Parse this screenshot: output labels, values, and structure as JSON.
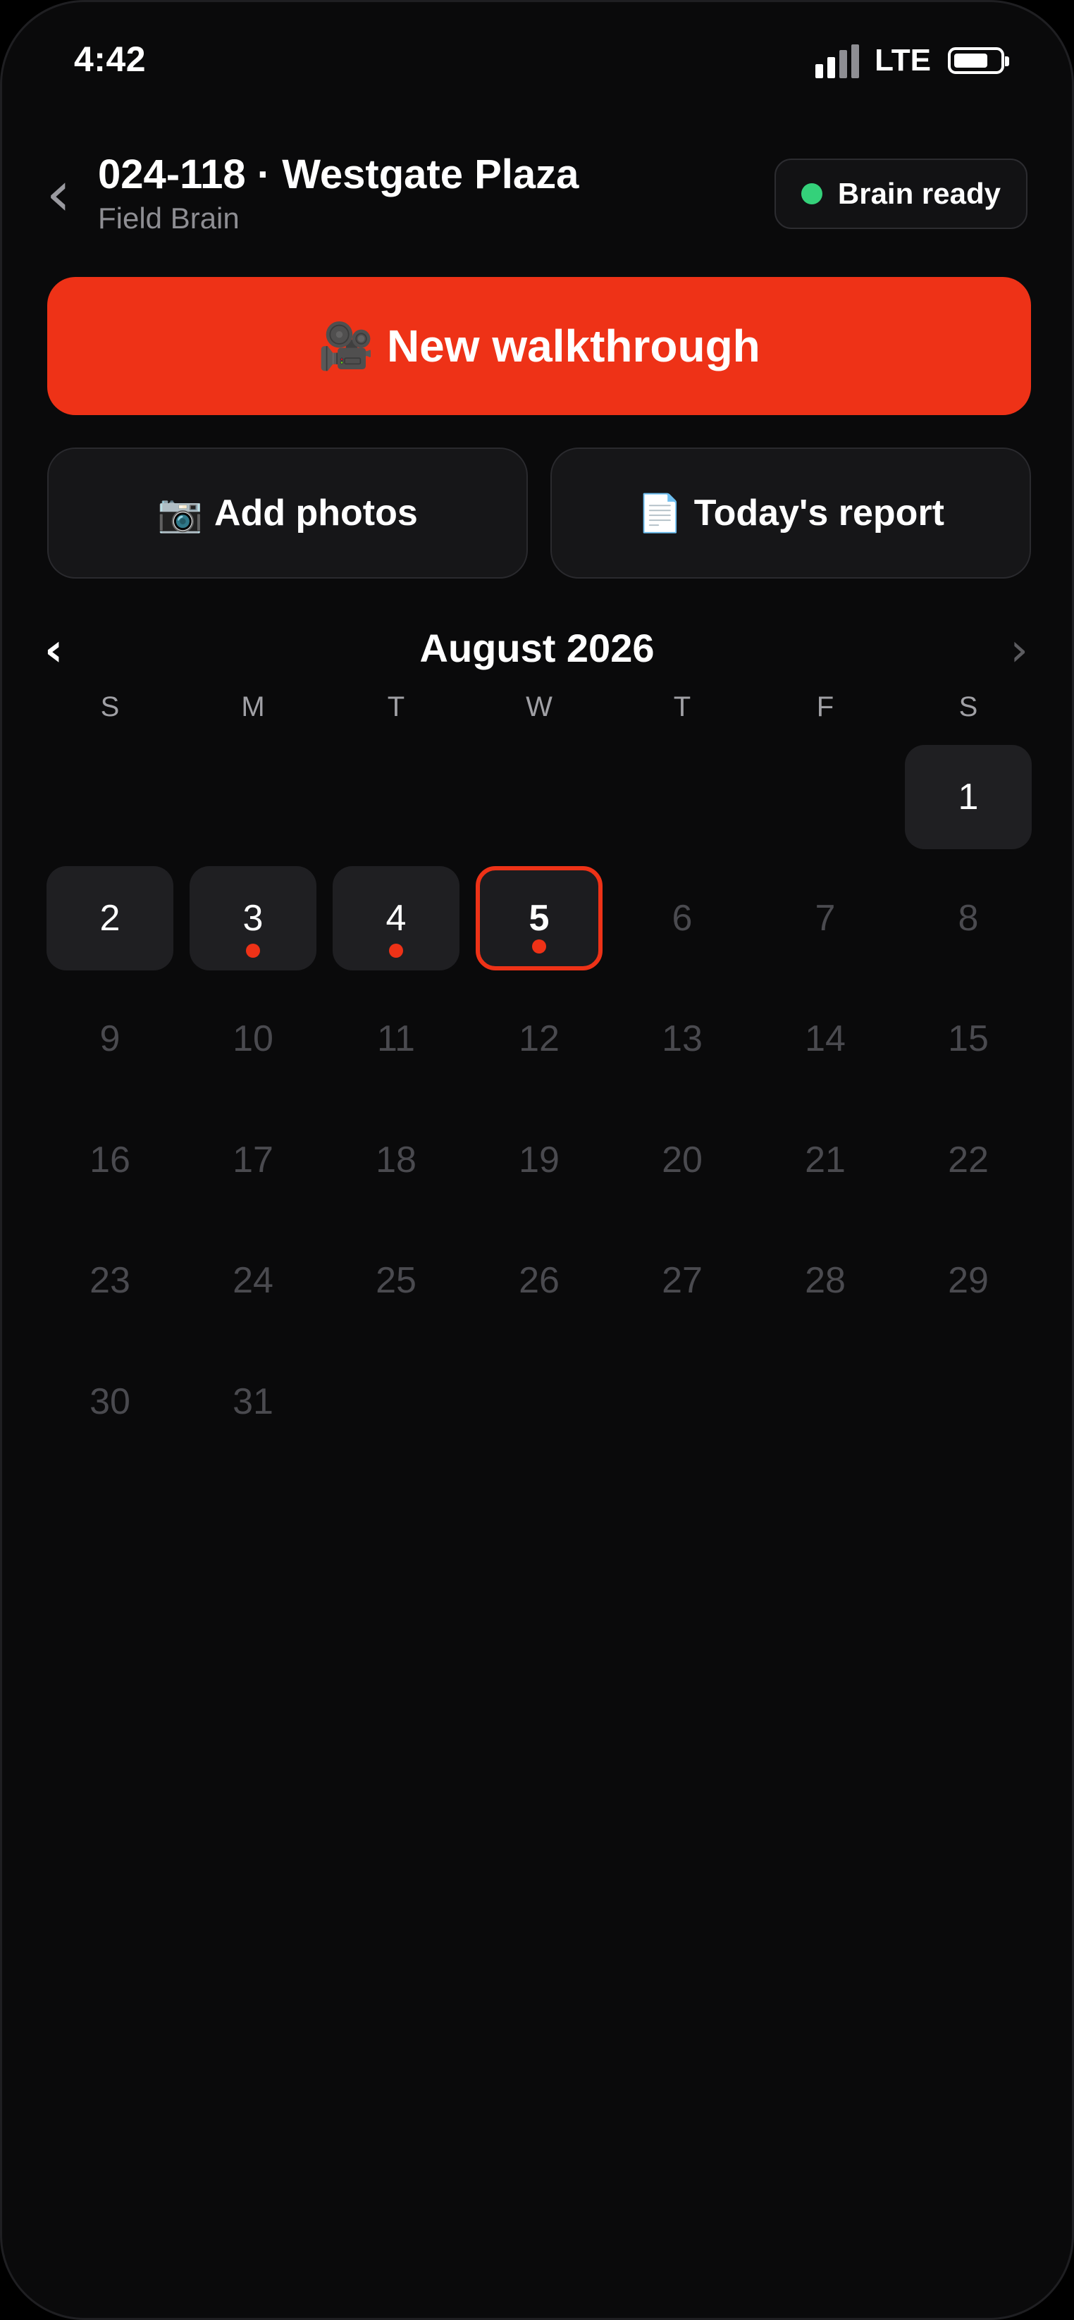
{
  "status_bar": {
    "time": "4:42",
    "network": "LTE",
    "battery_level": 0.75
  },
  "header": {
    "back_glyph": "‹",
    "title": "024-118 · Westgate Plaza",
    "subtitle": "Field Brain",
    "status": {
      "label": "Brain ready",
      "color": "#34d17a"
    }
  },
  "actions": {
    "primary": {
      "icon": "🎥",
      "label": "New walkthrough",
      "color": "#ee3217"
    },
    "add_photos": {
      "icon": "📷",
      "label": "Add photos"
    },
    "todays_report": {
      "icon": "📄",
      "label": "Today's report"
    }
  },
  "calendar": {
    "prev_glyph": "‹",
    "next_glyph": "›",
    "month_label": "August 2026",
    "weekdays": [
      "S",
      "M",
      "T",
      "W",
      "T",
      "F",
      "S"
    ],
    "first_weekday_index": 6,
    "days_in_month": 31,
    "days_with_data": [
      1,
      2,
      3,
      4,
      5
    ],
    "days_with_marker": [
      3,
      4,
      5
    ],
    "selected_day": 5
  }
}
